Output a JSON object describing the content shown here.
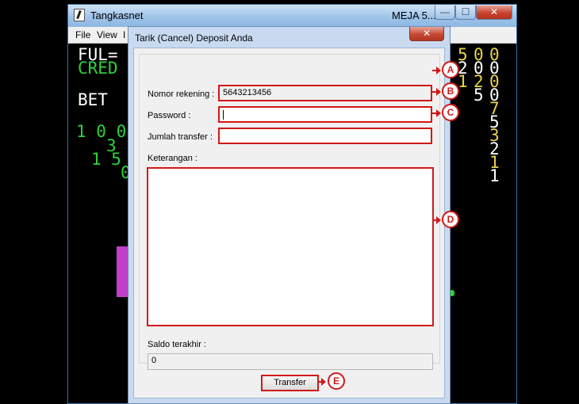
{
  "main_window": {
    "title": "Tangkasnet",
    "title_right": "MEJA 5...",
    "buttons": {
      "minimize": "—",
      "maximize": "☐",
      "close": "✕"
    },
    "menu": [
      "File",
      "View",
      "I"
    ]
  },
  "game": {
    "labels": {
      "ful": "FUL=",
      "cred": "CRED",
      "bet": "BET"
    },
    "left_numbers": [
      "1 0 0",
      "3",
      "1 5 0",
      "0"
    ],
    "right_columns": {
      "col1": [
        "5",
        "2",
        "1",
        "1"
      ],
      "col2": [
        "0",
        "0",
        "2",
        "5"
      ],
      "col3": [
        "0",
        "0",
        "0",
        "0",
        "7",
        "5",
        "3",
        "2",
        "1",
        "1"
      ]
    }
  },
  "dialog": {
    "title": "Tarik (Cancel) Deposit Anda",
    "close_label": "✕",
    "account_label": "Nomor rekening :",
    "account_value": "5643213456",
    "password_label": "Password :",
    "amount_label": "Jumlah transfer :",
    "note_label": "Keterangan :",
    "balance_label": "Saldo terakhir :",
    "balance_value": "0",
    "transfer_button": "Transfer"
  },
  "callouts": [
    "A",
    "B",
    "C",
    "D",
    "E"
  ],
  "colors": {
    "highlight": "#d11818",
    "game_green": "#2bd23b",
    "game_yellow": "#e8d24a"
  }
}
